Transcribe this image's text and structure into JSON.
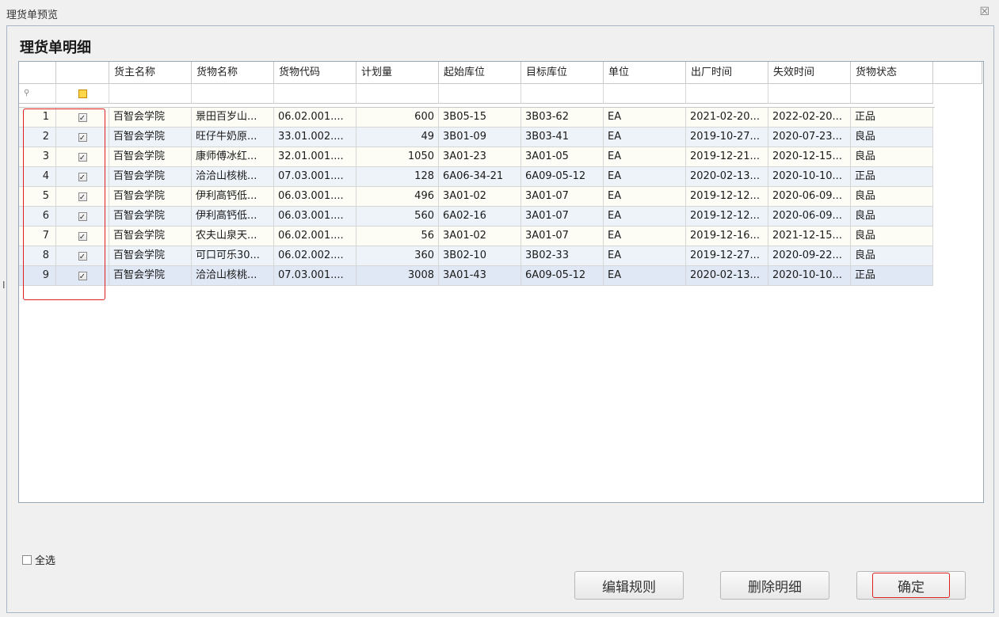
{
  "window": {
    "title": "理货单预览",
    "close_glyph": "☒"
  },
  "section": {
    "title": "理货单明细"
  },
  "grid": {
    "columns": [
      "货主名称",
      "货物名称",
      "货物代码",
      "计划量",
      "起始库位",
      "目标库位",
      "单位",
      "出厂时间",
      "失效时间",
      "货物状态"
    ],
    "filter_pin_icon": "pin-icon",
    "rows": [
      {
        "idx": "1",
        "checked": "✓",
        "owner": "百智会学院",
        "name": "景田百岁山...",
        "code": "06.02.001....",
        "qty": "600",
        "from": "3B05-15",
        "to": "3B03-62",
        "unit": "EA",
        "mfg": "2021-02-20...",
        "exp": "2022-02-20...",
        "state": "正品"
      },
      {
        "idx": "2",
        "checked": "✓",
        "owner": "百智会学院",
        "name": "旺仔牛奶原...",
        "code": "33.01.002....",
        "qty": "49",
        "from": "3B01-09",
        "to": "3B03-41",
        "unit": "EA",
        "mfg": "2019-10-27...",
        "exp": "2020-07-23...",
        "state": "良品"
      },
      {
        "idx": "3",
        "checked": "✓",
        "owner": "百智会学院",
        "name": "康师傅冰红...",
        "code": "32.01.001....",
        "qty": "1050",
        "from": "3A01-23",
        "to": "3A01-05",
        "unit": "EA",
        "mfg": "2019-12-21...",
        "exp": "2020-12-15...",
        "state": "良品"
      },
      {
        "idx": "4",
        "checked": "✓",
        "owner": "百智会学院",
        "name": "洽洽山核桃...",
        "code": "07.03.001....",
        "qty": "128",
        "from": "6A06-34-21",
        "to": "6A09-05-12",
        "unit": "EA",
        "mfg": "2020-02-13...",
        "exp": "2020-10-10...",
        "state": "正品"
      },
      {
        "idx": "5",
        "checked": "✓",
        "owner": "百智会学院",
        "name": "伊利高钙低...",
        "code": "06.03.001....",
        "qty": "496",
        "from": "3A01-02",
        "to": "3A01-07",
        "unit": "EA",
        "mfg": "2019-12-12...",
        "exp": "2020-06-09...",
        "state": "良品"
      },
      {
        "idx": "6",
        "checked": "✓",
        "owner": "百智会学院",
        "name": "伊利高钙低...",
        "code": "06.03.001....",
        "qty": "560",
        "from": "6A02-16",
        "to": "3A01-07",
        "unit": "EA",
        "mfg": "2019-12-12...",
        "exp": "2020-06-09...",
        "state": "良品"
      },
      {
        "idx": "7",
        "checked": "✓",
        "owner": "百智会学院",
        "name": "农夫山泉天...",
        "code": "06.02.001....",
        "qty": "56",
        "from": "3A01-02",
        "to": "3A01-07",
        "unit": "EA",
        "mfg": "2019-12-16...",
        "exp": "2021-12-15...",
        "state": "良品"
      },
      {
        "idx": "8",
        "checked": "✓",
        "owner": "百智会学院",
        "name": "可口可乐30...",
        "code": "06.02.002....",
        "qty": "360",
        "from": "3B02-10",
        "to": "3B02-33",
        "unit": "EA",
        "mfg": "2019-12-27...",
        "exp": "2020-09-22...",
        "state": "良品"
      },
      {
        "idx": "9",
        "checked": "✓",
        "owner": "百智会学院",
        "name": "洽洽山核桃...",
        "code": "07.03.001....",
        "qty": "3008",
        "from": "3A01-43",
        "to": "6A09-05-12",
        "unit": "EA",
        "mfg": "2020-02-13...",
        "exp": "2020-10-10...",
        "state": "正品"
      }
    ]
  },
  "footer": {
    "select_all_label": "全选",
    "edit_rule_label": "编辑规则",
    "delete_detail_label": "删除明细",
    "confirm_label": "确定"
  },
  "colors": {
    "highlight_red": "#e02020",
    "header_check_yellow": "#ffd54a"
  }
}
